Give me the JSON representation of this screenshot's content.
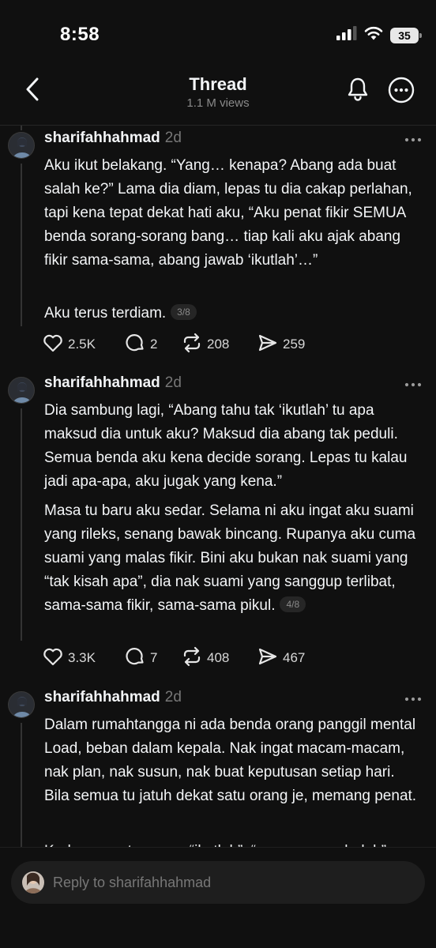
{
  "status": {
    "time": "8:58",
    "battery": "35",
    "icons": [
      "cellular-signal-icon",
      "wifi-icon",
      "battery-icon"
    ]
  },
  "header": {
    "title": "Thread",
    "views": "1.1 M views",
    "icons": [
      "back-arrow-icon",
      "bell-icon",
      "more-circle-icon"
    ]
  },
  "posts": [
    {
      "username": "sharifahhahmad",
      "time": "2d",
      "paragraphs": [
        "Aku ikut belakang. “Yang… kenapa? Abang ada buat salah ke?” Lama dia diam, lepas tu dia cakap perlahan, tapi kena tepat dekat hati aku, “Aku penat fikir SEMUA benda sorang-sorang bang… tiap kali aku ajak abang fikir sama-sama, abang jawab ‘ikutlah’…”",
        "Aku terus terdiam."
      ],
      "page": "3/8",
      "stats": {
        "likes": "2.5K",
        "replies": "2",
        "reposts": "208",
        "shares": "259"
      }
    },
    {
      "username": "sharifahhahmad",
      "time": "2d",
      "paragraphs": [
        "Dia sambung lagi, “Abang tahu tak ‘ikutlah’ tu apa maksud dia untuk aku? Maksud dia abang tak peduli. Semua benda aku kena decide sorang. Lepas tu kalau jadi apa-apa, aku jugak yang kena.”",
        "Masa tu baru aku sedar. Selama ni aku ingat aku suami yang rileks, senang bawak bincang. Rupanya aku cuma suami yang malas fikir. Bini aku bukan nak suami yang “tak kisah apa”, dia nak suami yang sanggup terlibat, sama-sama fikir, sama-sama pikul."
      ],
      "page": "4/8",
      "stats": {
        "likes": "3.3K",
        "replies": "7",
        "reposts": "408",
        "shares": "467"
      }
    },
    {
      "username": "sharifahhahmad",
      "time": "2d",
      "paragraphs": [
        "Dalam rumahtangga ni ada benda orang panggil mental Load, beban dalam kepala. Nak ingat macam-macam, nak plan, nak susun, nak buat keputusan setiap hari. Bila semua tu jatuh dekat satu orang je, memang penat.",
        "Kadang awat macam “ikutlah”, “apa-apa pun boleh”"
      ]
    }
  ],
  "reply": {
    "placeholder": "Reply to sharifahhahmad"
  },
  "colors": {
    "background": "#101010",
    "text": "#f3f5f7",
    "muted": "#777777",
    "divider": "#262626"
  }
}
